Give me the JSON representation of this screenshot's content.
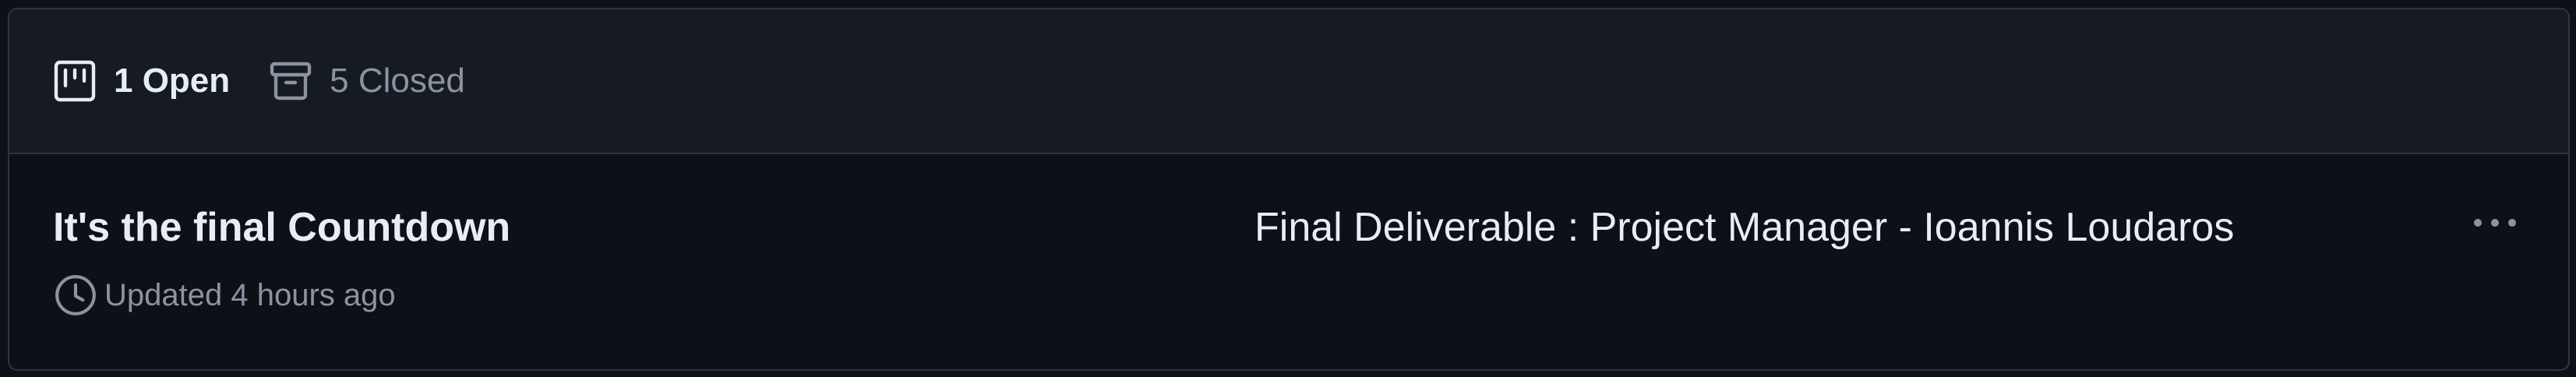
{
  "tabs": {
    "open": {
      "label": "1 Open",
      "icon": "project-icon"
    },
    "closed": {
      "label": "5 Closed",
      "icon": "archive-icon"
    }
  },
  "project": {
    "title": "It's the final Countdown",
    "updated": "Updated 4 hours ago",
    "description": "Final Deliverable : Project Manager - Ioannis Loudaros",
    "updated_icon": "clock-icon",
    "menu_icon": "kebab-horizontal-icon"
  },
  "colors": {
    "background": "#0d1117",
    "header_background": "#161b22",
    "border": "#30363d",
    "text_primary": "#e6edf3",
    "text_muted": "#8b949e"
  }
}
